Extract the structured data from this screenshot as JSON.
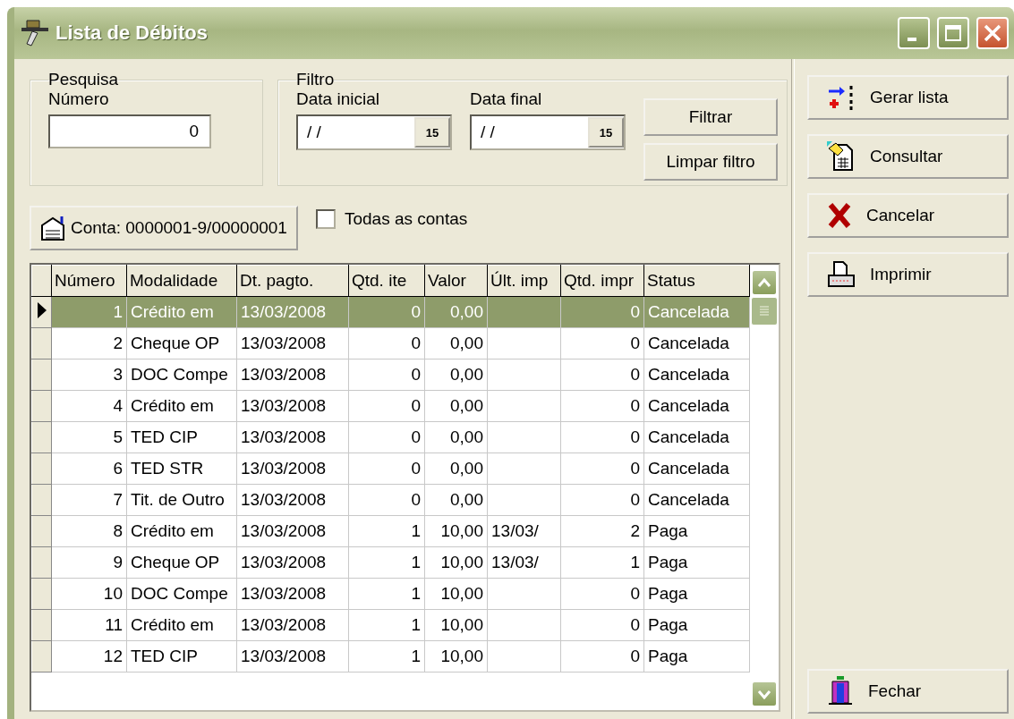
{
  "window": {
    "title": "Lista de Débitos"
  },
  "pesquisa": {
    "legend": "Pesquisa",
    "label": "Número",
    "value": "0"
  },
  "filtro": {
    "legend": "Filtro",
    "fields": [
      {
        "label": "Data inicial",
        "value": "/ /",
        "button": "15"
      },
      {
        "label": "Data final",
        "value": "/ /",
        "button": "15"
      }
    ],
    "buttons": [
      "Filtrar",
      "Limpar filtro"
    ]
  },
  "account_button": {
    "label": "Conta: 0000001-9/00000001"
  },
  "all_accounts": {
    "label": "Todas as contas",
    "checked": false
  },
  "table": {
    "columns": [
      {
        "label": "Número",
        "kind": "number"
      },
      {
        "label": "Modalidade",
        "kind": "text"
      },
      {
        "label": "Dt. pagto.",
        "kind": "text"
      },
      {
        "label": "Qtd. ite",
        "kind": "number"
      },
      {
        "label": "Valor",
        "kind": "number"
      },
      {
        "label": "Últ. imp",
        "kind": "text"
      },
      {
        "label": "Qtd. impr",
        "kind": "number"
      },
      {
        "label": "Status",
        "kind": "text"
      }
    ],
    "rows": [
      {
        "selected": true,
        "cells": [
          "1",
          "Crédito em",
          "13/03/2008",
          "0",
          "0,00",
          "",
          "0",
          "Cancelada"
        ]
      },
      {
        "selected": false,
        "cells": [
          "2",
          "Cheque OP",
          "13/03/2008",
          "0",
          "0,00",
          "",
          "0",
          "Cancelada"
        ]
      },
      {
        "selected": false,
        "cells": [
          "3",
          "DOC Compe",
          "13/03/2008",
          "0",
          "0,00",
          "",
          "0",
          "Cancelada"
        ]
      },
      {
        "selected": false,
        "cells": [
          "4",
          "Crédito em",
          "13/03/2008",
          "0",
          "0,00",
          "",
          "0",
          "Cancelada"
        ]
      },
      {
        "selected": false,
        "cells": [
          "5",
          "TED CIP",
          "13/03/2008",
          "0",
          "0,00",
          "",
          "0",
          "Cancelada"
        ]
      },
      {
        "selected": false,
        "cells": [
          "6",
          "TED STR",
          "13/03/2008",
          "0",
          "0,00",
          "",
          "0",
          "Cancelada"
        ]
      },
      {
        "selected": false,
        "cells": [
          "7",
          "Tit. de Outro",
          "13/03/2008",
          "0",
          "0,00",
          "",
          "0",
          "Cancelada"
        ]
      },
      {
        "selected": false,
        "cells": [
          "8",
          "Crédito em",
          "13/03/2008",
          "1",
          "10,00",
          "13/03/",
          "2",
          "Paga"
        ]
      },
      {
        "selected": false,
        "cells": [
          "9",
          "Cheque OP",
          "13/03/2008",
          "1",
          "10,00",
          "13/03/",
          "1",
          "Paga"
        ]
      },
      {
        "selected": false,
        "cells": [
          "10",
          "DOC Compe",
          "13/03/2008",
          "1",
          "10,00",
          "",
          "0",
          "Paga"
        ]
      },
      {
        "selected": false,
        "cells": [
          "11",
          "Crédito em",
          "13/03/2008",
          "1",
          "10,00",
          "",
          "0",
          "Paga"
        ]
      },
      {
        "selected": false,
        "cells": [
          "12",
          "TED CIP",
          "13/03/2008",
          "1",
          "10,00",
          "",
          "0",
          "Paga"
        ]
      }
    ]
  },
  "side_buttons": [
    {
      "label": "Gerar lista",
      "kind": "generate"
    },
    {
      "label": "Consultar",
      "kind": "query"
    },
    {
      "label": "Cancelar",
      "kind": "cancel"
    },
    {
      "label": "Imprimir",
      "kind": "print"
    }
  ],
  "close_button": {
    "label": "Fechar"
  }
}
